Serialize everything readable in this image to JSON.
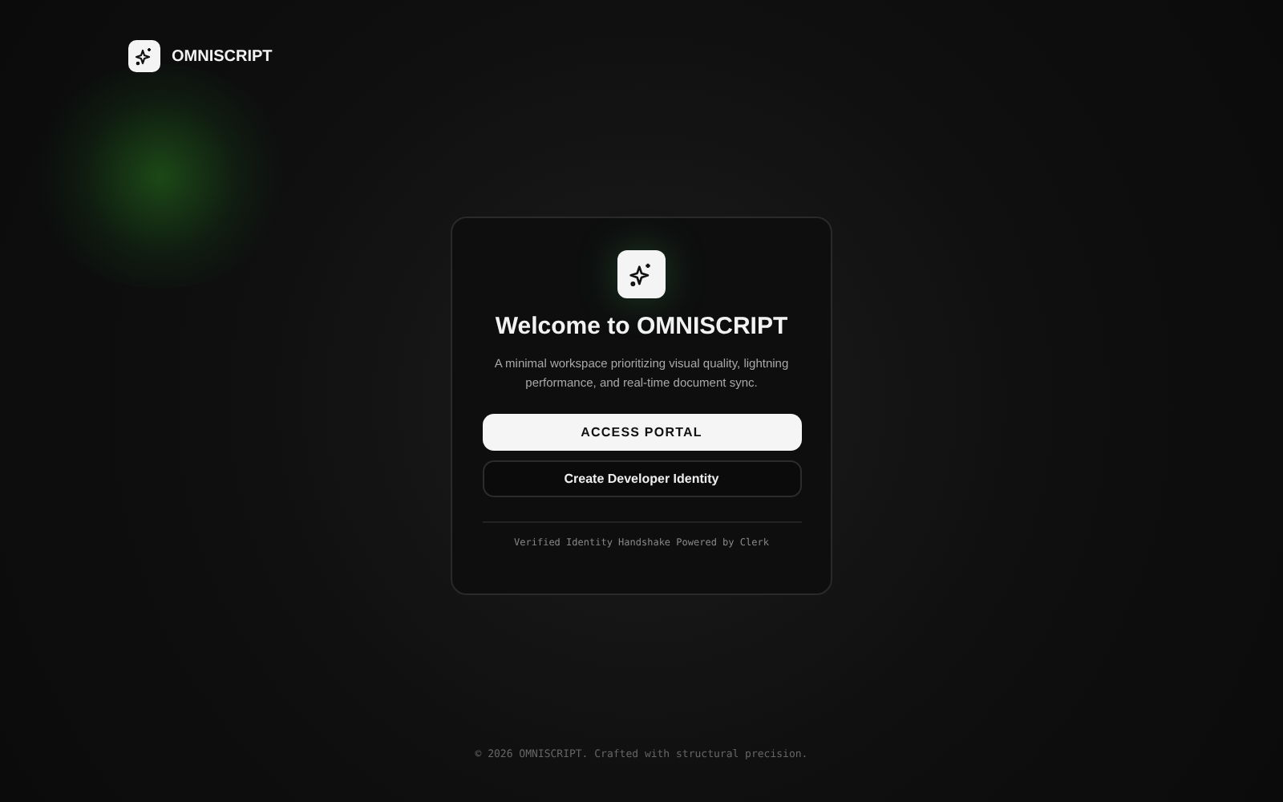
{
  "header": {
    "brand": "OMNISCRIPT"
  },
  "card": {
    "title": "Welcome to OMNISCRIPT",
    "description": "A minimal workspace prioritizing visual quality, lightning performance, and real-time document sync.",
    "buttons": [
      {
        "label": "ACCESS PORTAL",
        "kind": "primary"
      },
      {
        "label": "Create Developer Identity",
        "kind": "secondary"
      }
    ],
    "note": "Verified Identity Handshake Powered by Clerk"
  },
  "footer": "© 2026 OMNISCRIPT. Crafted with structural precision."
}
